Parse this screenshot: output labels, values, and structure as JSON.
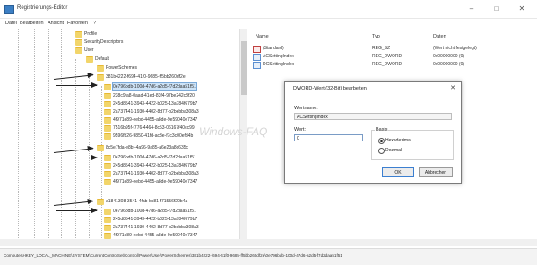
{
  "window": {
    "title": "Registrierungs-Editor",
    "minimize_glyph": "–",
    "maximize_glyph": "□",
    "close_glyph": "✕"
  },
  "menu": [
    "Datei",
    "Bearbeiten",
    "Ansicht",
    "Favoriten",
    "?"
  ],
  "tree": {
    "items": [
      {
        "label": "Profile"
      },
      {
        "label": "SecurityDescriptors"
      },
      {
        "label": "User"
      },
      {
        "label": "Default"
      },
      {
        "label": "PowerSchemes"
      },
      {
        "label": "381b4222-f694-41f0-9685-ff5bb260df2e"
      },
      {
        "label": "0e796bdb-100d-47d6-a2d5-f7d2daa51f51"
      },
      {
        "label": "238c9fa8-0aad-41ed-83f4-97be242c8f20"
      },
      {
        "label": "245d8541-3943-4422-b025-13a784f679b7"
      },
      {
        "label": "2a737441-1930-4402-8d77-b2bebba308a3"
      },
      {
        "label": "4f971e89-eebd-4455-a8de-9e59040e7347"
      },
      {
        "label": "7516b95f-f776-4464-8c53-06167f40cc99"
      },
      {
        "label": "9596fb26-9850-41fd-ac3e-f7c3c00efd4b"
      },
      {
        "label": "8c5e7fda-e8bf-4a96-9a85-a6e23a8c635c"
      },
      {
        "label": "0e796bdb-100d-47d6-a2d5-f7d2daa51f51"
      },
      {
        "label": "245d8541-3943-4422-b025-13a784f679b7"
      },
      {
        "label": "2a737441-1930-4402-8d77-b2bebba308a3"
      },
      {
        "label": "4f971e89-eebd-4455-a8de-9e59040e7347"
      },
      {
        "label": "a1841308-3541-4fab-bc81-f71556f20b4a"
      },
      {
        "label": "0e796bdb-100d-47d6-a2d5-f7d2daa51f51"
      },
      {
        "label": "245d8541-3943-4422-b025-13a784f679b7"
      },
      {
        "label": "2a737441-1930-4402-8d77-b2bebba308a3"
      },
      {
        "label": "4f971e89-eebd-4455-a8de-9e59040e7347"
      }
    ]
  },
  "list": {
    "headers": {
      "name": "Name",
      "type": "Typ",
      "data": "Daten"
    },
    "rows": [
      {
        "name": "(Standard)",
        "type": "REG_SZ",
        "data": "(Wert nicht festgelegt)"
      },
      {
        "name": "ACSettingIndex",
        "type": "REG_DWORD",
        "data": "0x00000000 (0)"
      },
      {
        "name": "DCSettingIndex",
        "type": "REG_DWORD",
        "data": "0x00000000 (0)"
      }
    ]
  },
  "watermark": "Windows-FAQ",
  "dialog": {
    "title": "DWORD-Wert (32-Bit) bearbeiten",
    "close_glyph": "✕",
    "name_label": "Wertname:",
    "name_value": "ACSettingIndex",
    "data_label": "Wert:",
    "data_value": "0",
    "base_label": "Basis",
    "base_options": [
      "Hexadezimal",
      "Dezimal"
    ],
    "ok_label": "OK",
    "cancel_label": "Abbrechen"
  },
  "status": "Computer\\HKEY_LOCAL_MACHINE\\SYSTEM\\CurrentControlSet\\Control\\Power\\User\\PowerSchemes\\381b4222-f694-41f0-9685-ff5bb260df2e\\0e796bdb-100d-47d6-a2d5-f7d2daa51f51"
}
